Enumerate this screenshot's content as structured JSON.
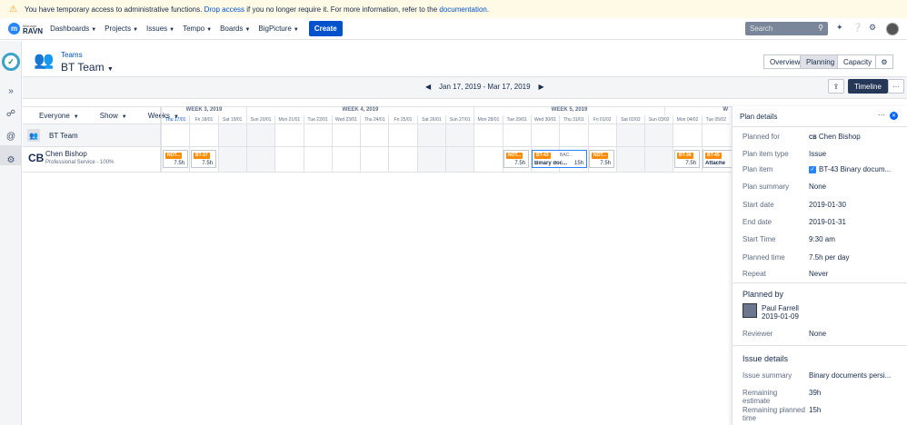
{
  "banner": {
    "text_before": "You have temporary access to administrative functions.",
    "link_drop": "Drop access",
    "text_mid": "if you no longer require it. For more information, refer to the",
    "link_doc": "documentation",
    "text_end": "."
  },
  "logo": {
    "small": "iManage",
    "big": "RAVN"
  },
  "nav": {
    "items": [
      "Dashboards",
      "Projects",
      "Issues",
      "Tempo",
      "Boards",
      "BigPicture"
    ],
    "create": "Create",
    "search_placeholder": "Search"
  },
  "header": {
    "breadcrumb": "Teams",
    "title": "BT Team",
    "tabs": [
      "Overview",
      "Planning",
      "Capacity"
    ]
  },
  "toolbar": {
    "range": "Jan 17, 2019 - Mar 17, 2019",
    "timeline": "Timeline",
    "more": "···"
  },
  "grid_controls": {
    "everyone": "Everyone",
    "show": "Show",
    "weeks": "Weeks"
  },
  "weeks": [
    "WEEK 3, 2019",
    "WEEK 4, 2019",
    "WEEK 5, 2019",
    "W"
  ],
  "days": [
    "Thu 17/01",
    "Fri 18/01",
    "Sat 19/01",
    "Sun 20/01",
    "Mon 21/01",
    "Tue 22/01",
    "Wed 23/01",
    "Thu 24/01",
    "Fri 25/01",
    "Sat 26/01",
    "Sun 27/01",
    "Mon 28/01",
    "Tue 29/01",
    "Wed 30/01",
    "Thu 31/01",
    "Fri 01/02",
    "Sat 02/02",
    "Sun 03/02",
    "Mon 04/02",
    "Tue 05/02"
  ],
  "team_row": {
    "name": "BT Team"
  },
  "person": {
    "initials": "CB",
    "name": "Chen Bishop",
    "role": "Professional Service - 100%"
  },
  "plans": [
    {
      "key": "NOT...",
      "hours": "7.5h",
      "summary": "",
      "status": ""
    },
    {
      "key": "BT-37",
      "hours": "7.5h",
      "summary": "",
      "status": ""
    },
    {
      "key": "NOT...",
      "hours": "7.5h",
      "summary": "",
      "status": ""
    },
    {
      "key": "BT-43",
      "hours": "15h",
      "summary": "Binary doc...",
      "status": "BAC..."
    },
    {
      "key": "NOT...",
      "hours": "7.5h",
      "summary": "",
      "status": ""
    },
    {
      "key": "BT-36",
      "hours": "7.5h",
      "summary": "",
      "status": ""
    },
    {
      "key": "BT-45",
      "hours": "",
      "summary": "Attache",
      "status": ""
    }
  ],
  "panel": {
    "title": "Plan details",
    "fields": [
      {
        "label": "Planned for",
        "value": "Chen Bishop",
        "prefix": "CB"
      },
      {
        "label": "Plan item type",
        "value": "Issue"
      },
      {
        "label": "Plan item",
        "value": "BT-43 Binary docum..."
      },
      {
        "label": "Plan summary",
        "value": "None"
      },
      {
        "label": "Start date",
        "value": "2019-01-30"
      },
      {
        "label": "End date",
        "value": "2019-01-31"
      },
      {
        "label": "Start Time",
        "value": "9:30 am"
      },
      {
        "label": "Planned time",
        "value": "7.5h per day"
      },
      {
        "label": "Repeat",
        "value": "Never"
      }
    ],
    "planned_by_title": "Planned by",
    "planned_by_name": "Paul Farrell",
    "planned_by_date": "2019-01-09",
    "reviewer_label": "Reviewer",
    "reviewer_value": "None",
    "issue_title": "Issue details",
    "issue_fields": [
      {
        "label": "Issue summary",
        "value": "Binary documents persi..."
      },
      {
        "label": "Remaining estimate",
        "value": "39h"
      },
      {
        "label": "Remaining planned time",
        "value": "15h"
      }
    ]
  },
  "colors": {
    "primary": "#0052cc",
    "key_badge": "#ff8b00",
    "dark_button": "#253858",
    "banner_bg": "#fffae6"
  }
}
